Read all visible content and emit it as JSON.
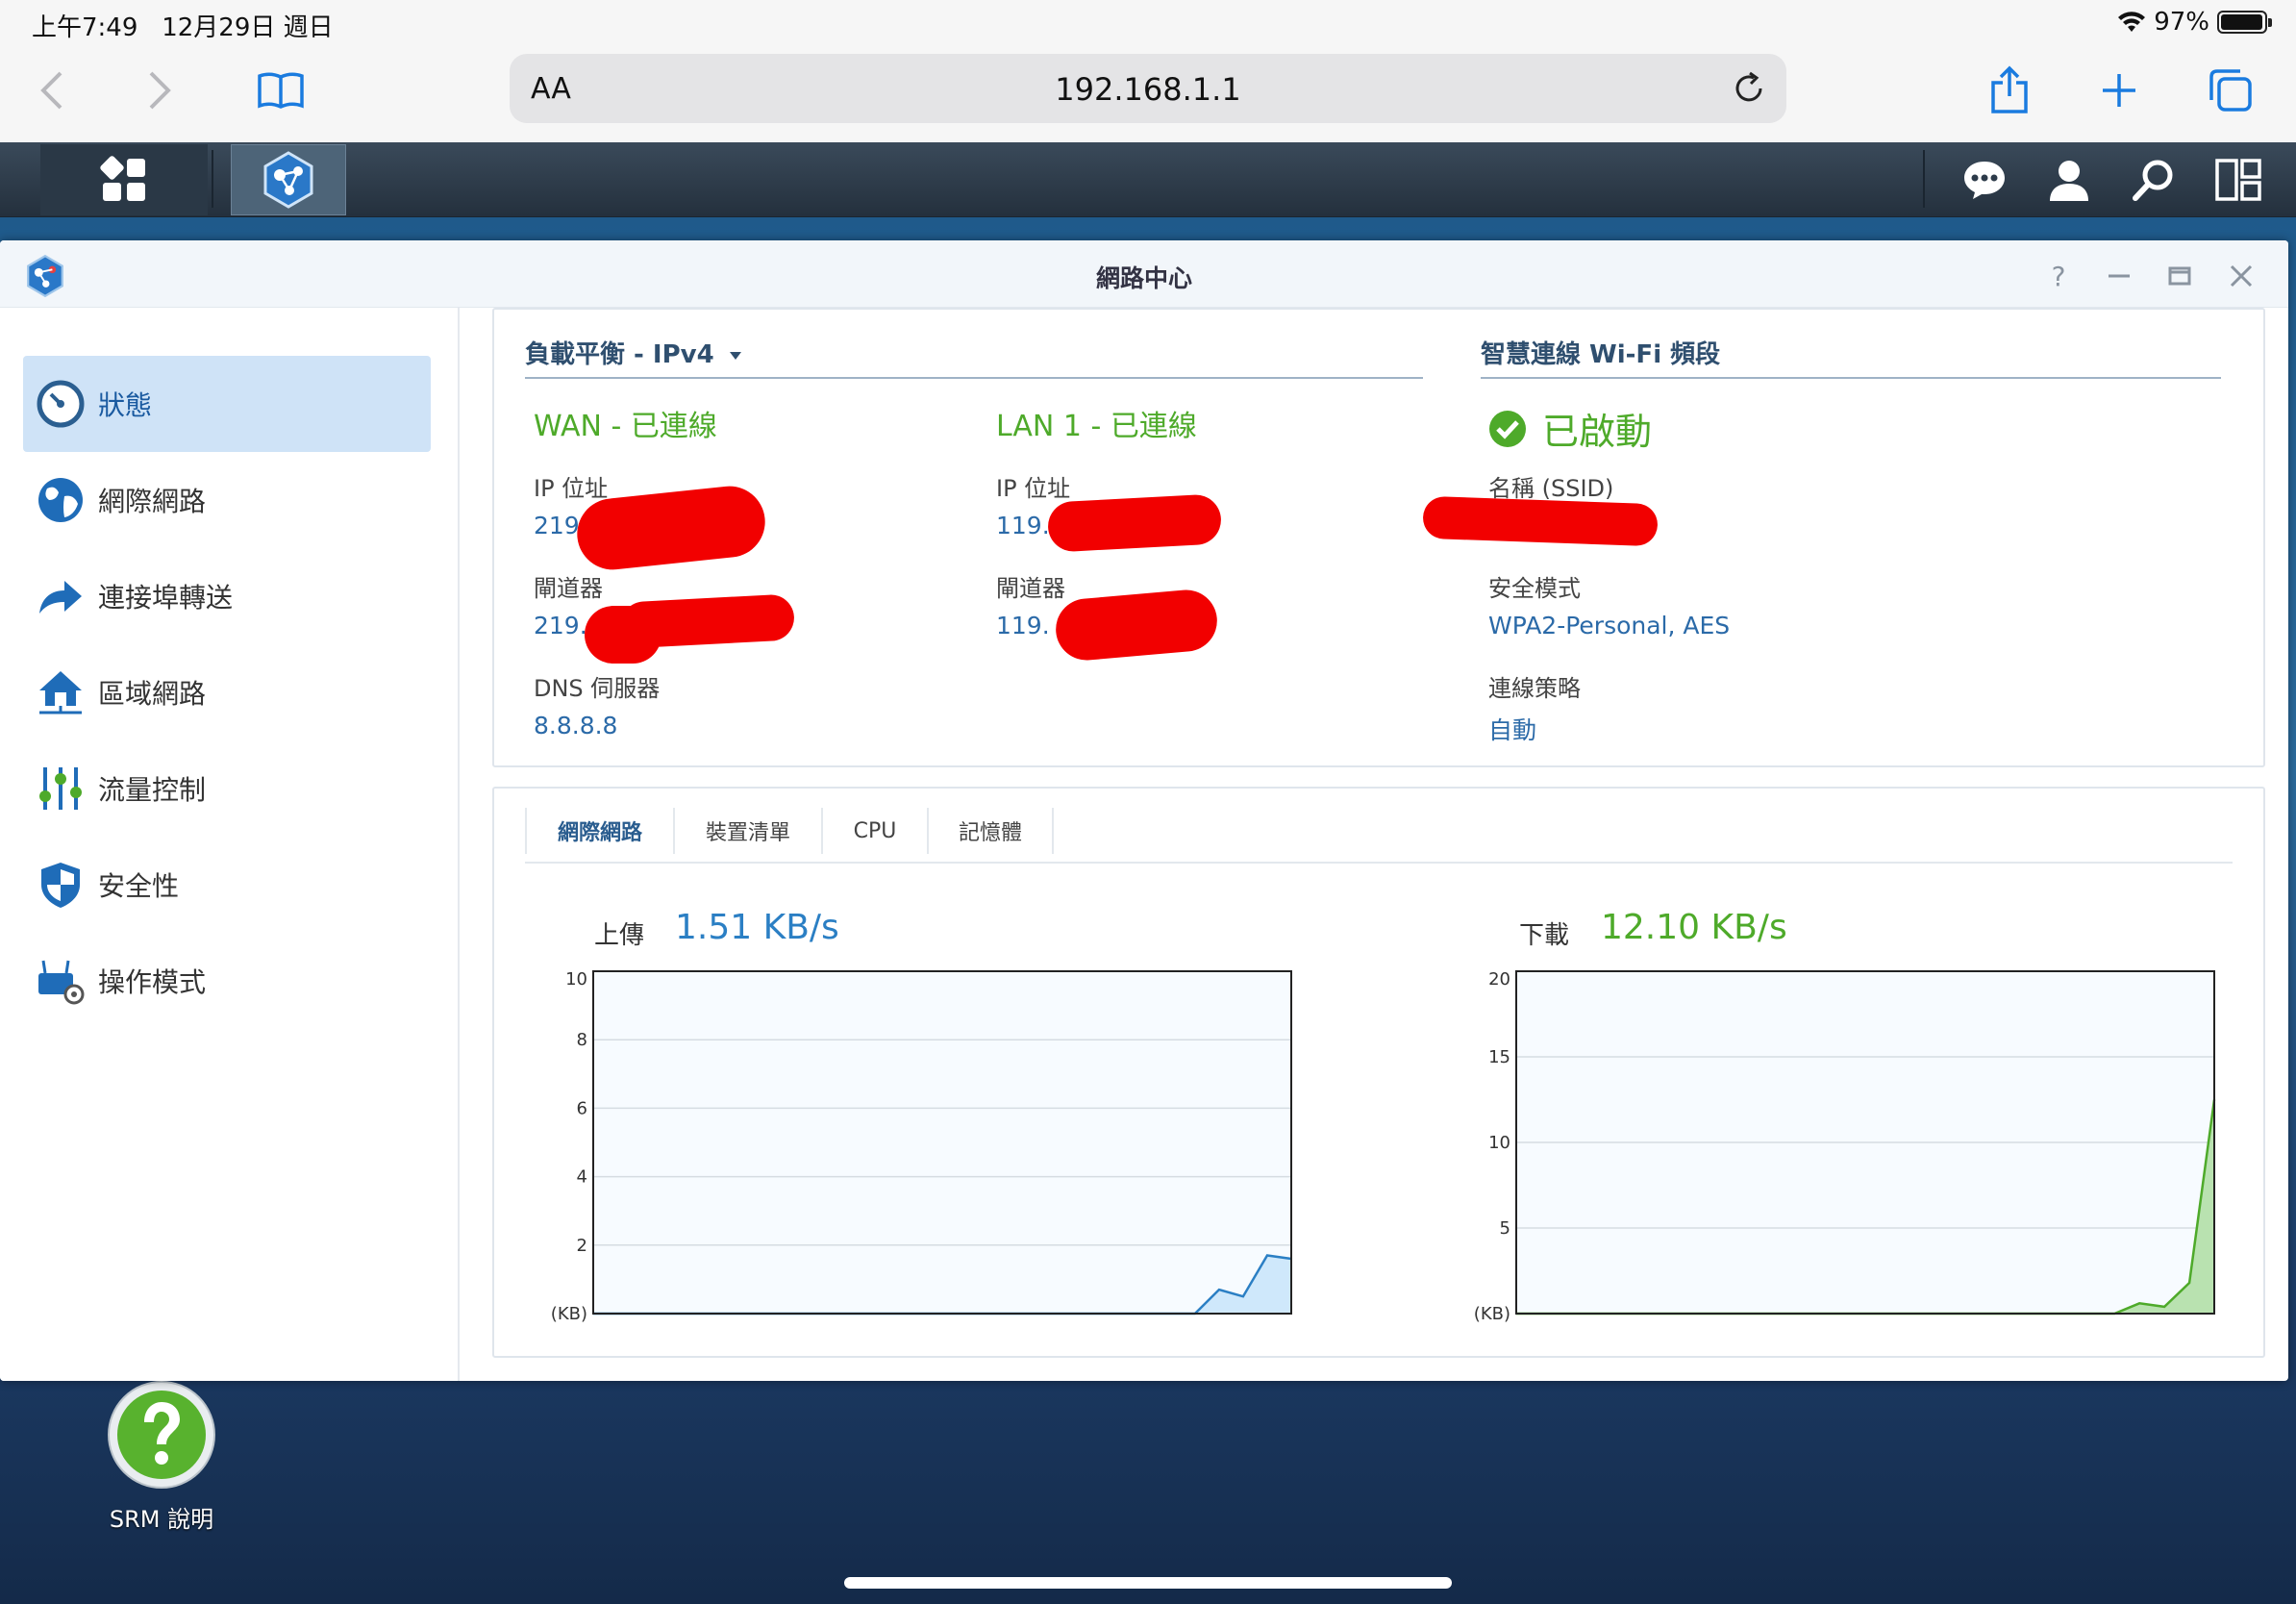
{
  "status_bar": {
    "time": "上午7:49",
    "date": "12月29日 週日",
    "battery": "97%",
    "battery_level": 0.97
  },
  "safari": {
    "aa": "AA",
    "url": "192.168.1.1"
  },
  "window": {
    "title": "網路中心",
    "help": "?"
  },
  "sidebar": {
    "items": [
      {
        "label": "狀態",
        "icon": "gauge-icon",
        "active": true
      },
      {
        "label": "網際網路",
        "icon": "globe-icon",
        "active": false
      },
      {
        "label": "連接埠轉送",
        "icon": "forward-arrow-icon",
        "active": false
      },
      {
        "label": "區域網路",
        "icon": "home-network-icon",
        "active": false
      },
      {
        "label": "流量控制",
        "icon": "sliders-icon",
        "active": false
      },
      {
        "label": "安全性",
        "icon": "shield-icon",
        "active": false
      },
      {
        "label": "操作模式",
        "icon": "router-gear-icon",
        "active": false
      }
    ]
  },
  "connection": {
    "header": "負載平衡 - IPv4",
    "wan": {
      "title": "WAN - 已連線",
      "ip_label": "IP 位址",
      "ip_value": "219",
      "gateway_label": "閘道器",
      "gateway_value": "219.",
      "dns_label": "DNS 伺服器",
      "dns_value": "8.8.8.8"
    },
    "lan": {
      "title": "LAN 1 - 已連線",
      "ip_label": "IP 位址",
      "ip_value": "119.",
      "gateway_label": "閘道器",
      "gateway_value": "119."
    }
  },
  "wifi": {
    "header": "智慧連線 Wi-Fi 頻段",
    "status": "已啟動",
    "ssid_label": "名稱 (SSID)",
    "security_label": "安全模式",
    "security_value": "WPA2-Personal, AES",
    "policy_label": "連線策略",
    "policy_value": "自動"
  },
  "tabs": [
    "網際網路",
    "裝置清單",
    "CPU",
    "記憶體"
  ],
  "traffic": {
    "upload_label": "上傳",
    "upload_value": "1.51 KB/s",
    "download_label": "下載",
    "download_value": "12.10 KB/s"
  },
  "desktop": {
    "help_label": "SRM 說明"
  },
  "colors": {
    "upload": "#2b7fc4",
    "download": "#4eaa2a",
    "accent": "#1a5aa0"
  },
  "chart_data": [
    {
      "type": "area",
      "unit_label": "(KB)",
      "ylim": [
        0,
        10
      ],
      "yticks": [
        2,
        4,
        6,
        8,
        10
      ],
      "values": [
        0,
        0,
        0,
        0,
        0,
        0,
        0,
        0,
        0,
        0,
        0,
        0,
        0,
        0,
        0,
        0,
        0,
        0,
        0,
        0,
        0,
        0,
        0,
        0,
        0,
        0,
        0.7,
        0.5,
        1.7,
        1.6
      ],
      "grid": true
    },
    {
      "type": "area",
      "unit_label": "(KB)",
      "ylim": [
        0,
        20
      ],
      "yticks": [
        5,
        10,
        15,
        20
      ],
      "values": [
        0,
        0,
        0,
        0,
        0,
        0,
        0,
        0,
        0,
        0,
        0,
        0,
        0,
        0,
        0,
        0,
        0,
        0,
        0,
        0,
        0,
        0,
        0,
        0,
        0,
        0.6,
        0.4,
        1.8,
        12.5
      ],
      "grid": true
    }
  ]
}
